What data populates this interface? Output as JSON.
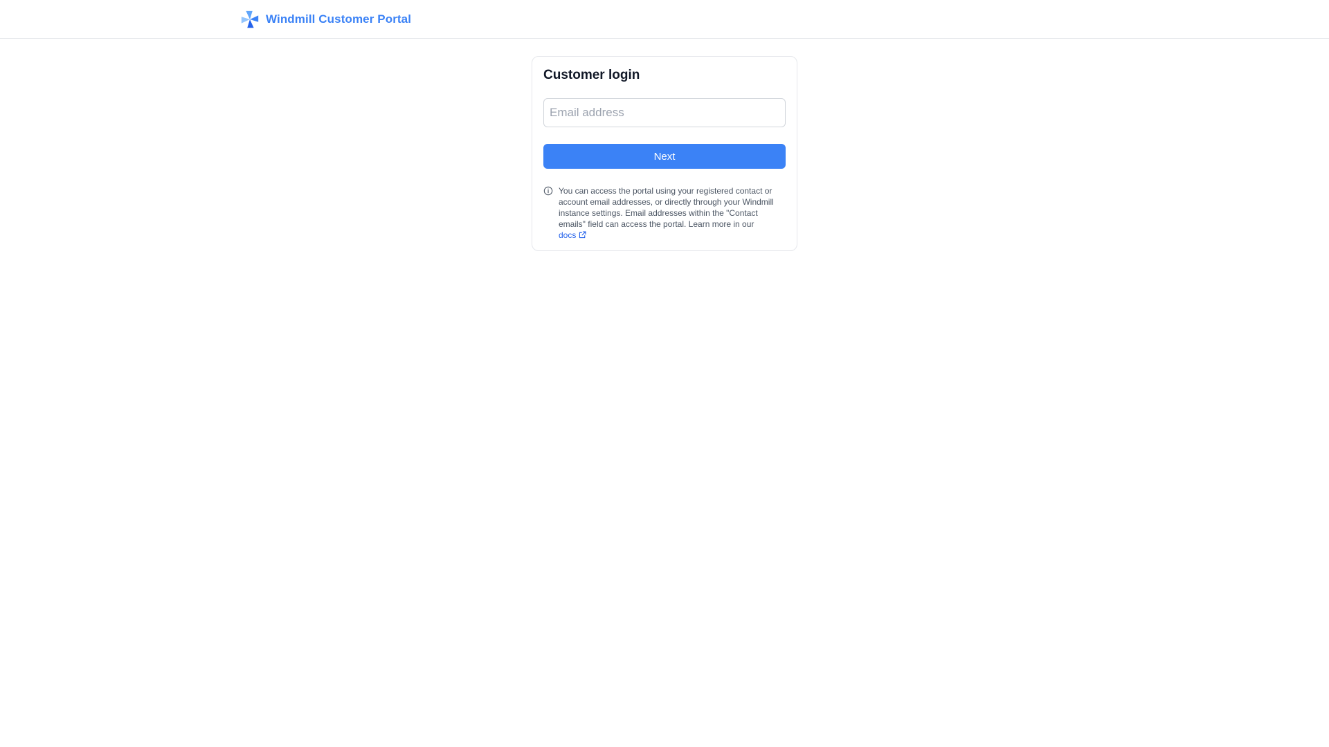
{
  "header": {
    "brand_title": "Windmill Customer Portal",
    "logo_icon": "windmill-logo-icon",
    "accent_color": "#3b82f6"
  },
  "login": {
    "title": "Customer login",
    "email_placeholder": "Email address",
    "email_value": "",
    "next_label": "Next",
    "next_color": "#3b82f6",
    "info_icon": "info-circle-icon",
    "info_text": "You can access the portal using your registered contact or account email addresses, or directly through your Windmill instance settings. Email addresses within the \"Contact emails\" field can access the portal. Learn more in our",
    "docs_label": "docs",
    "docs_icon": "external-link-icon"
  }
}
